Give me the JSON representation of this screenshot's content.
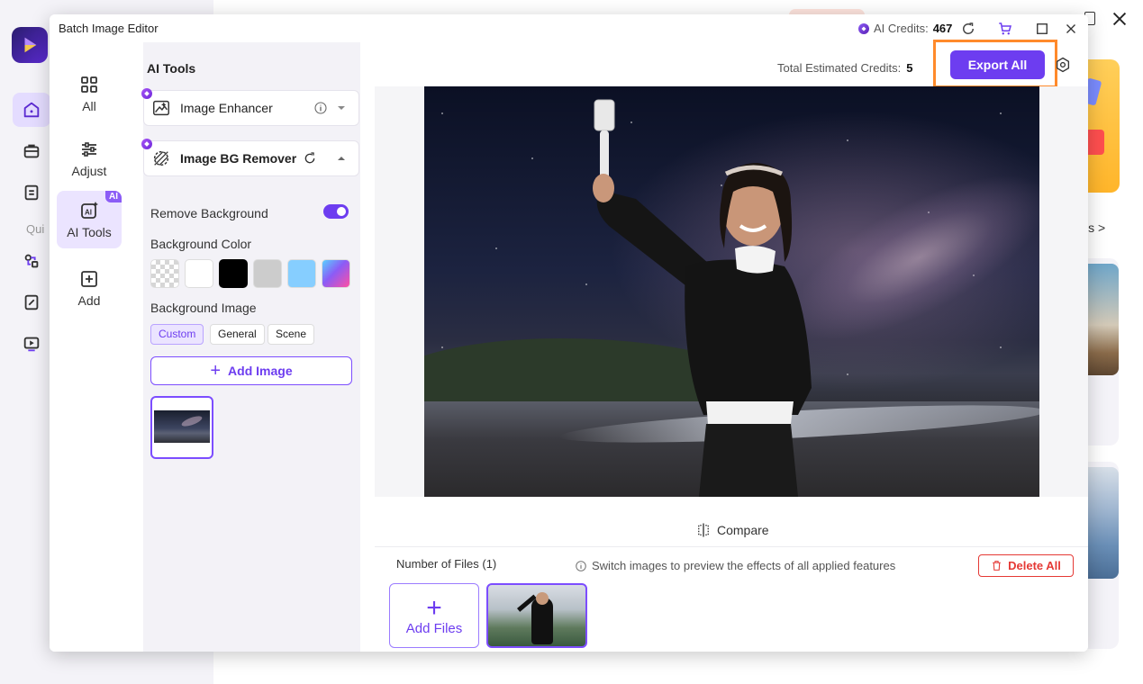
{
  "background_app": {
    "quick_label": "Qui",
    "tools_link": "ls >"
  },
  "dialog": {
    "title": "Batch Image Editor",
    "credits_label": "AI Credits:",
    "credits_value": "467"
  },
  "rail": {
    "items": [
      {
        "label": "All",
        "icon": "grid-icon"
      },
      {
        "label": "Adjust",
        "icon": "sliders-icon"
      },
      {
        "label": "AI Tools",
        "icon": "ai-tools-icon",
        "badge": "AI"
      },
      {
        "label": "Add",
        "icon": "plus-box-icon"
      }
    ]
  },
  "panel": {
    "heading": "AI Tools",
    "tools": [
      {
        "label": "Image Enhancer",
        "expanded": false
      },
      {
        "label": "Image BG Remover",
        "expanded": true
      }
    ],
    "remove_background_label": "Remove Background",
    "remove_background_on": true,
    "background_color_label": "Background Color",
    "colors": [
      "transparent",
      "#ffffff",
      "#000000",
      "#cccccc",
      "#86ceff",
      "gradient"
    ],
    "background_image_label": "Background Image",
    "image_tabs": [
      "Custom",
      "General",
      "Scene"
    ],
    "active_image_tab": "Custom",
    "add_image_label": "Add Image"
  },
  "main": {
    "estimated_label": "Total Estimated Credits:",
    "estimated_value": "5",
    "export_label": "Export All",
    "compare_label": "Compare",
    "files_count_label": "Number of Files (1)",
    "hint": "Switch images to preview the effects of all applied features",
    "delete_all_label": "Delete All",
    "add_files_label": "Add Files"
  },
  "colors": {
    "accent": "#6d3df0",
    "highlight": "#ff8a2b",
    "danger": "#e53935"
  }
}
